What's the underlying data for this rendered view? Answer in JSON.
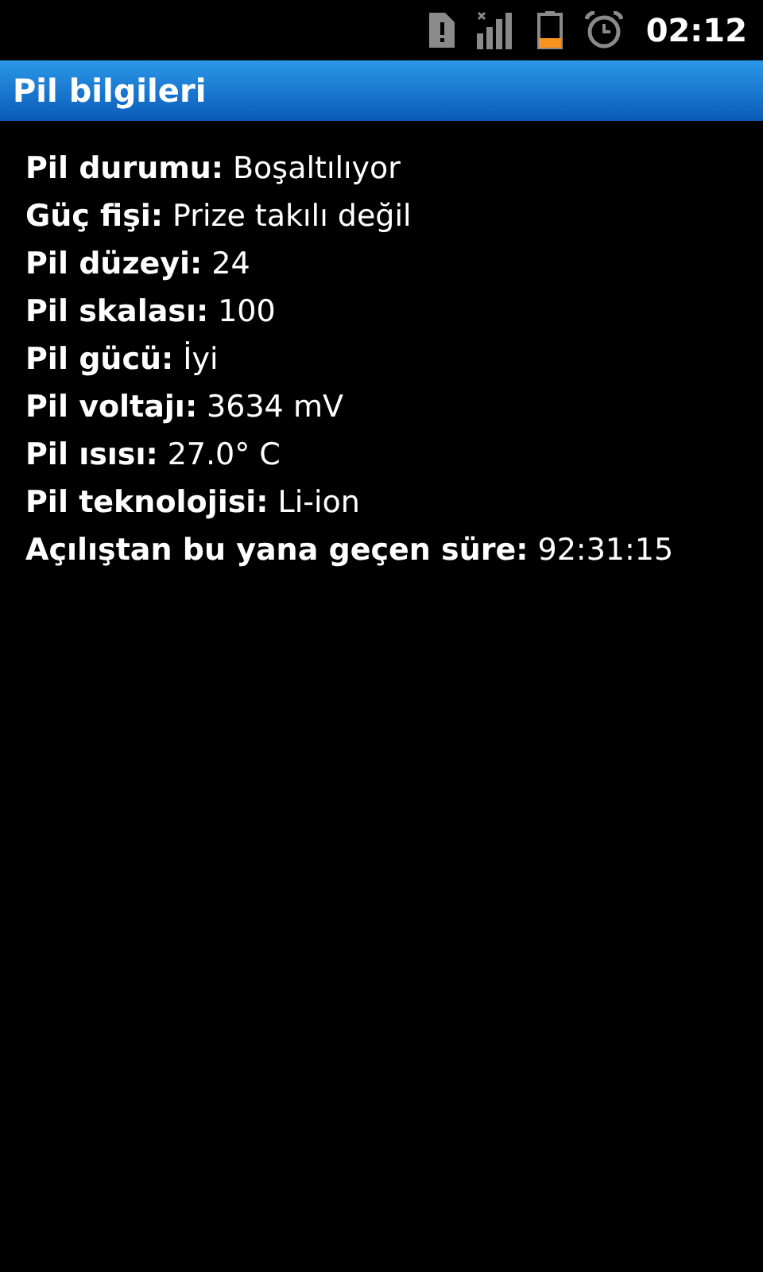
{
  "status_bar": {
    "time": "02:12"
  },
  "title": "Pil bilgileri",
  "rows": [
    {
      "label": "Pil durumu:",
      "value": "Boşaltılıyor"
    },
    {
      "label": "Güç fişi:",
      "value": "Prize takılı değil"
    },
    {
      "label": "Pil düzeyi:",
      "value": "24"
    },
    {
      "label": "Pil skalası:",
      "value": "100"
    },
    {
      "label": "Pil gücü:",
      "value": "İyi"
    },
    {
      "label": "Pil voltajı:",
      "value": "3634 mV"
    },
    {
      "label": "Pil ısısı:",
      "value": "27.0° C"
    },
    {
      "label": "Pil teknolojisi:",
      "value": "Li-ion"
    },
    {
      "label": "Açılıştan bu yana geçen süre:",
      "value": "92:31:15"
    }
  ]
}
